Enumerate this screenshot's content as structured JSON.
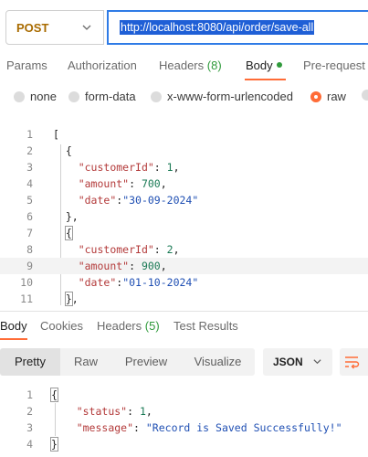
{
  "request": {
    "method": "POST",
    "url": "http://localhost:8080/api/order/save-all"
  },
  "tabs": [
    {
      "label": "Params"
    },
    {
      "label": "Authorization"
    },
    {
      "label": "Headers",
      "count": "(8)"
    },
    {
      "label": "Body",
      "active": true
    },
    {
      "label": "Pre-request"
    }
  ],
  "body_types": [
    "none",
    "form-data",
    "x-www-form-urlencoded",
    "raw"
  ],
  "body_selected": "raw",
  "editor": {
    "line_numbers": [
      "1",
      "2",
      "3",
      "4",
      "5",
      "6",
      "7",
      "8",
      "9",
      "10",
      "11"
    ],
    "lines": [
      "[",
      "  {",
      "    \"customerId\": 1,",
      "    \"amount\": 700,",
      "    \"date\":\"30-09-2024\"",
      "  },",
      "  {",
      "    \"customerId\": 2,",
      "    \"amount\": 900,",
      "    \"date\":\"01-10-2024\"",
      "  },"
    ]
  },
  "response": {
    "tabs": [
      {
        "label": "Body",
        "active": true
      },
      {
        "label": "Cookies"
      },
      {
        "label": "Headers",
        "count": "(5)"
      },
      {
        "label": "Test Results"
      }
    ],
    "views": [
      "Pretty",
      "Raw",
      "Preview",
      "Visualize"
    ],
    "view_selected": "Pretty",
    "format": "JSON",
    "line_numbers": [
      "1",
      "2",
      "3",
      "4"
    ],
    "lines": [
      "{",
      "    \"status\": 1,",
      "    \"message\": \"Record is Saved Successfully!\"",
      "}"
    ]
  },
  "colors": {
    "accent": "#ff6c37",
    "method": "#a96b00",
    "count": "#2f9a3b",
    "url_focus": "#2f7be6"
  }
}
